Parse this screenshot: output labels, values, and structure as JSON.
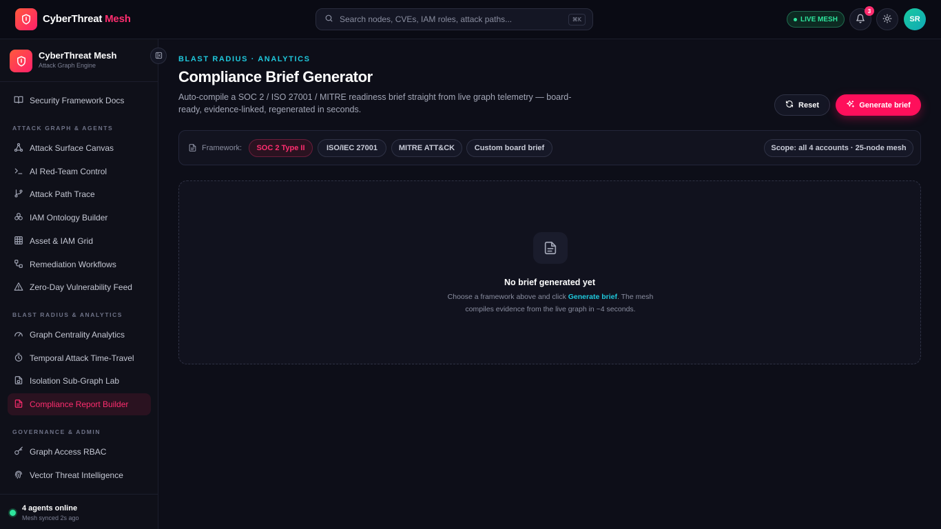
{
  "app": {
    "brand_name": "CyberThreat",
    "brand_accent": "Mesh",
    "accent_color": "#ff2d6f",
    "teal_color": "#1fc8dc",
    "live_color": "#2ee59d"
  },
  "topbar": {
    "search_placeholder": "Search nodes, CVEs, IAM roles, attack paths...",
    "search_shortcut": "⌘K",
    "live_label": "LIVE MESH",
    "notification_count": "3",
    "avatar_initials": "SR",
    "icons": [
      "search-icon",
      "bell-icon",
      "sun-icon"
    ]
  },
  "sidebar": {
    "title": "CyberThreat Mesh",
    "subtitle": "Attack Graph Engine",
    "docs_item": "Security Framework Docs",
    "sections": [
      {
        "label": "ATTACK GRAPH & AGENTS",
        "items": [
          "Attack Surface Canvas",
          "AI Red-Team Control",
          "Attack Path Trace",
          "IAM Ontology Builder",
          "Asset & IAM Grid",
          "Remediation Workflows",
          "Zero-Day Vulnerability Feed"
        ]
      },
      {
        "label": "BLAST RADIUS & ANALYTICS",
        "items": [
          "Graph Centrality Analytics",
          "Temporal Attack Time-Travel",
          "Isolation Sub-Graph Lab",
          "Compliance Report Builder"
        ]
      },
      {
        "label": "GOVERNANCE & ADMIN",
        "items": [
          "Graph Access RBAC",
          "Vector Threat Intelligence"
        ]
      }
    ],
    "active_item": "Compliance Report Builder",
    "footer": {
      "status": "4 agents online",
      "sync": "Mesh synced 2s ago"
    }
  },
  "main": {
    "eyebrow": "BLAST RADIUS · ANALYTICS",
    "title": "Compliance Brief Generator",
    "description": "Auto-compile a SOC 2 / ISO 27001 / MITRE readiness brief straight from live graph telemetry — board-ready, evidence-linked, regenerated in seconds.",
    "reset_label": "Reset",
    "generate_label": "Generate brief",
    "framework_label": "Framework:",
    "frameworks": [
      "SOC 2 Type II",
      "ISO/IEC 27001",
      "MITRE ATT&CK",
      "Custom board brief"
    ],
    "selected_framework": "SOC 2 Type II",
    "scope": "Scope: all 4 accounts · 25-node mesh",
    "empty": {
      "title": "No brief generated yet",
      "desc_before": "Choose a framework above and click ",
      "desc_link": "Generate brief",
      "desc_after": ". The mesh compiles evidence from the live graph in ~4 seconds."
    }
  }
}
